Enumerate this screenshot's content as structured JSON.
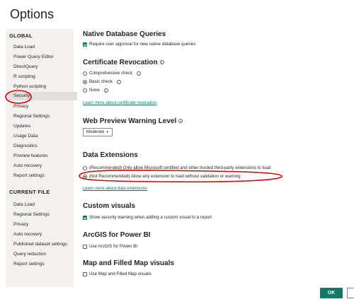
{
  "dialog": {
    "title": "Options"
  },
  "sidebar": {
    "global_header": "GLOBAL",
    "global_items": [
      "Data Load",
      "Power Query Editor",
      "DirectQuery",
      "R scripting",
      "Python scripting",
      "Security",
      "Privacy",
      "Regional Settings",
      "Updates",
      "Usage Data",
      "Diagnostics",
      "Preview features",
      "Auto recovery",
      "Report settings"
    ],
    "current_header": "CURRENT FILE",
    "current_items": [
      "Data Load",
      "Regional Settings",
      "Privacy",
      "Auto recovery",
      "Published dataset settings",
      "Query reduction",
      "Report settings"
    ],
    "selected": "Security"
  },
  "sections": {
    "native_db": {
      "title": "Native Database Queries",
      "opt": "Require user approval for new native database queries"
    },
    "cert": {
      "title": "Certificate Revocation",
      "opt1": "Comprehensive check",
      "opt2": "Basic check",
      "opt3": "None",
      "link": "Learn more about certificate revocation"
    },
    "web_preview": {
      "title": "Web Preview Warning Level",
      "value": "Moderate"
    },
    "extensions": {
      "title": "Data Extensions",
      "opt1": "(Recommended) Only allow Microsoft certified and other trusted third-party extensions to load",
      "opt2": "(Not Recommended) Allow any extension to load without validation or warning",
      "link": "Learn more about data extensions"
    },
    "custom_visuals": {
      "title": "Custom visuals",
      "opt": "Show security warning when adding a custom visual to a report"
    },
    "arcgis": {
      "title": "ArcGIS for Power BI",
      "opt": "Use ArcGIS for Power BI"
    },
    "maps": {
      "title": "Map and Filled Map visuals",
      "opt": "Use Map and Filled Map visuals"
    }
  },
  "footer": {
    "ok_label": "OK"
  },
  "colors": {
    "accent": "#117865",
    "annotation": "#e00000"
  }
}
